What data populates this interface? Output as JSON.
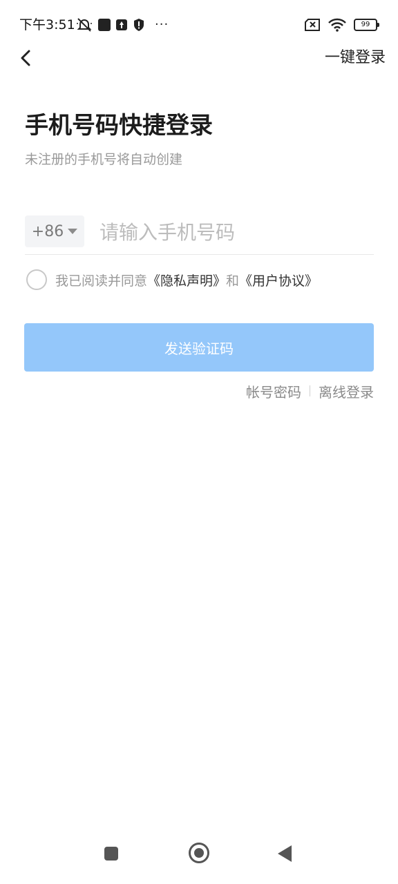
{
  "status_bar": {
    "time": "下午3:51",
    "battery": "99",
    "more": "···"
  },
  "header": {
    "quick_login": "一键登录"
  },
  "main": {
    "title": "手机号码快捷登录",
    "subtitle": "未注册的手机号将自动创建",
    "country_code": "+86",
    "phone_placeholder": "请输入手机号码",
    "agreement": {
      "prefix": "我已阅读并同意",
      "privacy_link": "《隐私声明》",
      "and": "和",
      "user_agreement_link": "《用户协议》"
    },
    "send_code_label": "发送验证码",
    "account_password_link": "帐号密码",
    "offline_login_link": "离线登录"
  },
  "colors": {
    "primary_disabled": "#94c7fa",
    "muted_text": "#999999"
  }
}
